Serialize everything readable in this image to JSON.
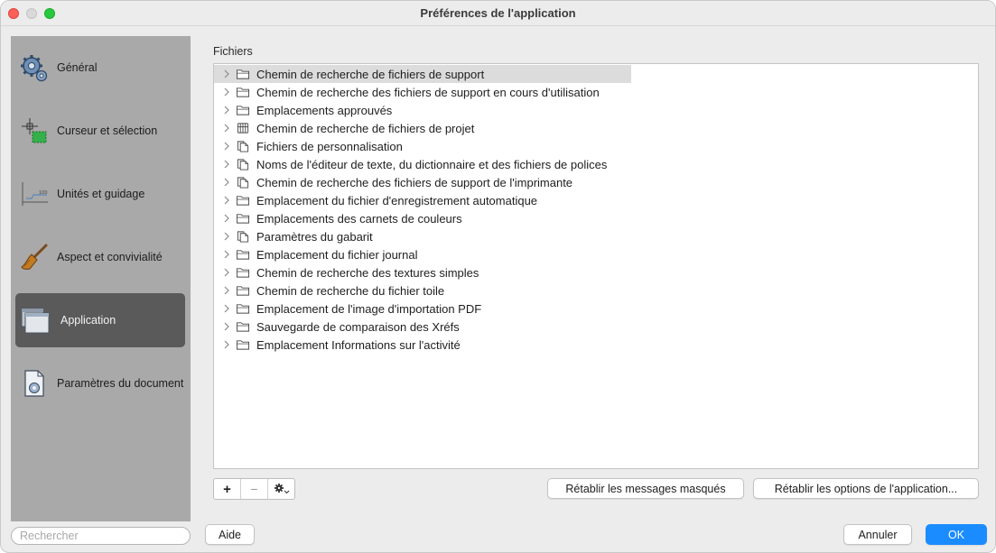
{
  "window": {
    "title": "Préférences de l'application"
  },
  "sidebar": {
    "items": [
      {
        "label": "Général",
        "icon": "gears-icon"
      },
      {
        "label": "Curseur et sélection",
        "icon": "cursor-selection-icon"
      },
      {
        "label": "Unités et guidage",
        "icon": "ruler-icon"
      },
      {
        "label": "Aspect et convivialité",
        "icon": "brush-icon"
      },
      {
        "label": "Application",
        "icon": "windows-icon",
        "selected": true
      },
      {
        "label": "Paramètres du document",
        "icon": "document-settings-icon"
      }
    ],
    "search_placeholder": "Rechercher"
  },
  "main": {
    "section_title": "Fichiers",
    "tree": [
      {
        "label": "Chemin de recherche de fichiers de support",
        "icon": "folder-icon",
        "selected": true
      },
      {
        "label": "Chemin de recherche des fichiers de support en cours d'utilisation",
        "icon": "folder-icon"
      },
      {
        "label": "Emplacements approuvés",
        "icon": "folder-icon"
      },
      {
        "label": "Chemin de recherche de fichiers de projet",
        "icon": "project-icon"
      },
      {
        "label": "Fichiers de personnalisation",
        "icon": "files-icon"
      },
      {
        "label": "Noms de l'éditeur de texte, du dictionnaire et des fichiers de polices",
        "icon": "files-icon"
      },
      {
        "label": "Chemin de recherche des fichiers de support de l'imprimante",
        "icon": "files-icon"
      },
      {
        "label": "Emplacement du fichier d'enregistrement automatique",
        "icon": "folder-icon"
      },
      {
        "label": "Emplacements des carnets de couleurs",
        "icon": "folder-icon"
      },
      {
        "label": "Paramètres du gabarit",
        "icon": "files-icon"
      },
      {
        "label": "Emplacement du fichier journal",
        "icon": "folder-icon"
      },
      {
        "label": "Chemin de recherche des textures simples",
        "icon": "folder-icon"
      },
      {
        "label": "Chemin de recherche du fichier toile",
        "icon": "folder-icon"
      },
      {
        "label": "Emplacement de l'image d'importation PDF",
        "icon": "folder-icon"
      },
      {
        "label": "Sauvegarde de comparaison des Xréfs",
        "icon": "folder-icon"
      },
      {
        "label": "Emplacement Informations sur l'activité",
        "icon": "folder-icon"
      }
    ],
    "tools": {
      "add": "+",
      "remove": "−"
    },
    "reset_messages_label": "Rétablir les messages masqués",
    "reset_options_label": "Rétablir les options de l'application..."
  },
  "footer": {
    "help_label": "Aide",
    "cancel_label": "Annuler",
    "ok_label": "OK"
  }
}
